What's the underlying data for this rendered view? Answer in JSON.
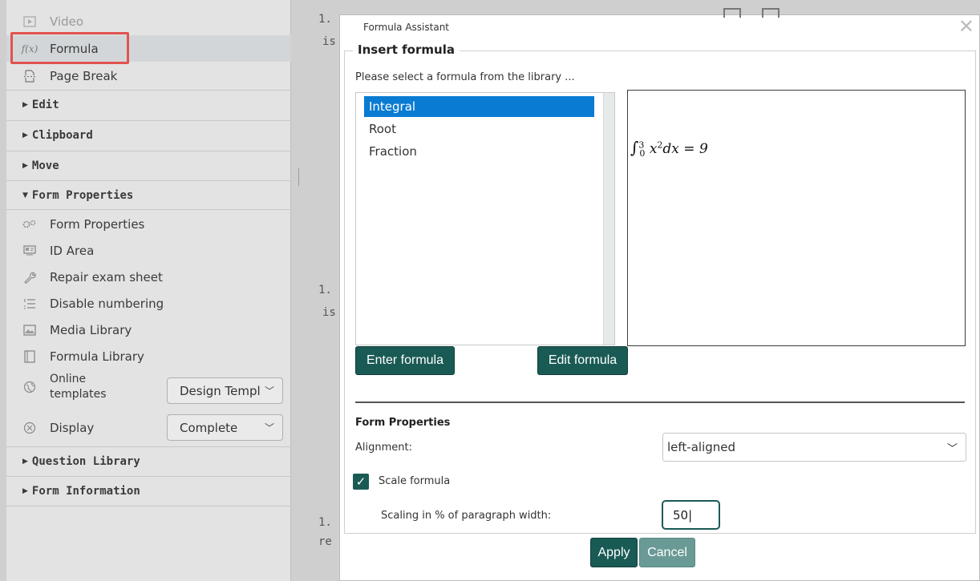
{
  "sidebar": {
    "top_items": [
      {
        "label": "Video",
        "icon": "video-icon"
      },
      {
        "label": "Formula",
        "icon": "formula-icon"
      },
      {
        "label": "Page Break",
        "icon": "page-break-icon"
      }
    ],
    "sections": {
      "edit": "Edit",
      "clipboard": "Clipboard",
      "move": "Move",
      "form_properties": "Form Properties",
      "question_library": "Question Library",
      "form_information": "Form Information"
    },
    "form_items": [
      {
        "label": "Form Properties",
        "icon": "gears-icon"
      },
      {
        "label": "ID Area",
        "icon": "id-card-icon"
      },
      {
        "label": "Repair exam sheet",
        "icon": "wrench-icon"
      },
      {
        "label": "Disable numbering",
        "icon": "numbered-list-icon"
      },
      {
        "label": "Media Library",
        "icon": "image-icon"
      },
      {
        "label": "Formula Library",
        "icon": "book-icon"
      }
    ],
    "online_templates_label_line1": "Online",
    "online_templates_label_line2": "templates",
    "online_templates_value": "Design Templ",
    "display_label": "Display",
    "display_value": "Complete"
  },
  "document": {
    "snippets": [
      "1.",
      "is",
      "1.",
      "is",
      "1.",
      "re"
    ]
  },
  "dialog": {
    "title": "Formula Assistant",
    "legend": "Insert formula",
    "hint": "Please select a formula from the library ...",
    "library": [
      "Integral",
      "Root",
      "Fraction"
    ],
    "selected_index": 0,
    "preview": {
      "integral_sign": "∫",
      "upper": "3",
      "lower": "0",
      "body": "x",
      "power": "2",
      "rest": "dx = 9"
    },
    "enter_formula": "Enter formula",
    "edit_formula": "Edit formula",
    "form_properties_title": "Form Properties",
    "alignment_label": "Alignment:",
    "alignment_value": "left-aligned",
    "scale_checked": true,
    "scale_label": "Scale formula",
    "scaling_label": "Scaling in % of paragraph width:",
    "scaling_value": "50",
    "apply": "Apply",
    "cancel": "Cancel"
  },
  "colors": {
    "accent": "#1a5a55",
    "selection": "#0a7bd2",
    "highlight": "#e0534f"
  }
}
